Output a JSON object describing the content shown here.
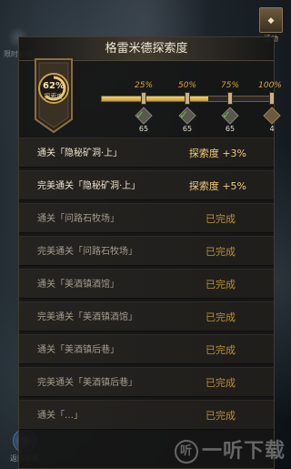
{
  "panel": {
    "title": "格雷米德探索度"
  },
  "badge": {
    "percent": "62%",
    "caption": "探索度"
  },
  "progress": {
    "fraction": 0.62,
    "milestones": [
      {
        "label": "25%",
        "count": "65",
        "claimed": true
      },
      {
        "label": "50%",
        "count": "65",
        "claimed": true
      },
      {
        "label": "75%",
        "count": "65",
        "claimed": true
      },
      {
        "label": "100%",
        "count": "4",
        "claimed": false
      }
    ]
  },
  "tasks": [
    {
      "name": "通关「隐秘矿洞·上」",
      "reward": "探索度 +3%",
      "done": false
    },
    {
      "name": "完美通关「隐秘矿洞·上」",
      "reward": "探索度 +5%",
      "done": false
    },
    {
      "name": "通关「问路石牧场」",
      "reward": "已完成",
      "done": true
    },
    {
      "name": "完美通关「问路石牧场」",
      "reward": "已完成",
      "done": true
    },
    {
      "name": "通关「美酒镇酒馆」",
      "reward": "已完成",
      "done": true
    },
    {
      "name": "完美通关「美酒镇酒馆」",
      "reward": "已完成",
      "done": true
    },
    {
      "name": "通关「美酒镇后巷」",
      "reward": "已完成",
      "done": true
    },
    {
      "name": "完美通关「美酒镇后巷」",
      "reward": "已完成",
      "done": true
    },
    {
      "name": "通关「…」",
      "reward": "已完成",
      "done": true
    }
  ],
  "side": {
    "left_label": "限时秘境",
    "right_label": "活动",
    "bottom_label": "返回秘境"
  },
  "watermark": "一听下载",
  "colors": {
    "accent": "#d7a73a",
    "claimed": "#5ec23b"
  }
}
